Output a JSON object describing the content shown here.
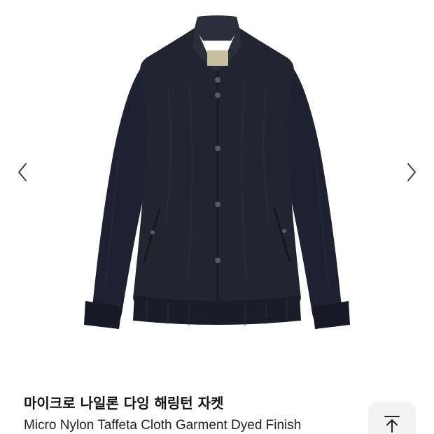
{
  "gallery": {
    "prev_icon": "chevron-left-icon",
    "next_icon": "chevron-right-icon",
    "image_subject": "navy harrington jacket"
  },
  "product": {
    "title": "마이크로 나일론 다잉 해링턴 자켓",
    "subtitle": "Micro Nylon Taffeta Cloth Garment Dyed Finish"
  },
  "floating": {
    "scroll_top_icon": "arrow-up-to-top-icon"
  },
  "colors": {
    "jacket": "#1f2230",
    "text": "#111111",
    "arrow": "#333333",
    "button_bg": "#f3f3f3"
  }
}
